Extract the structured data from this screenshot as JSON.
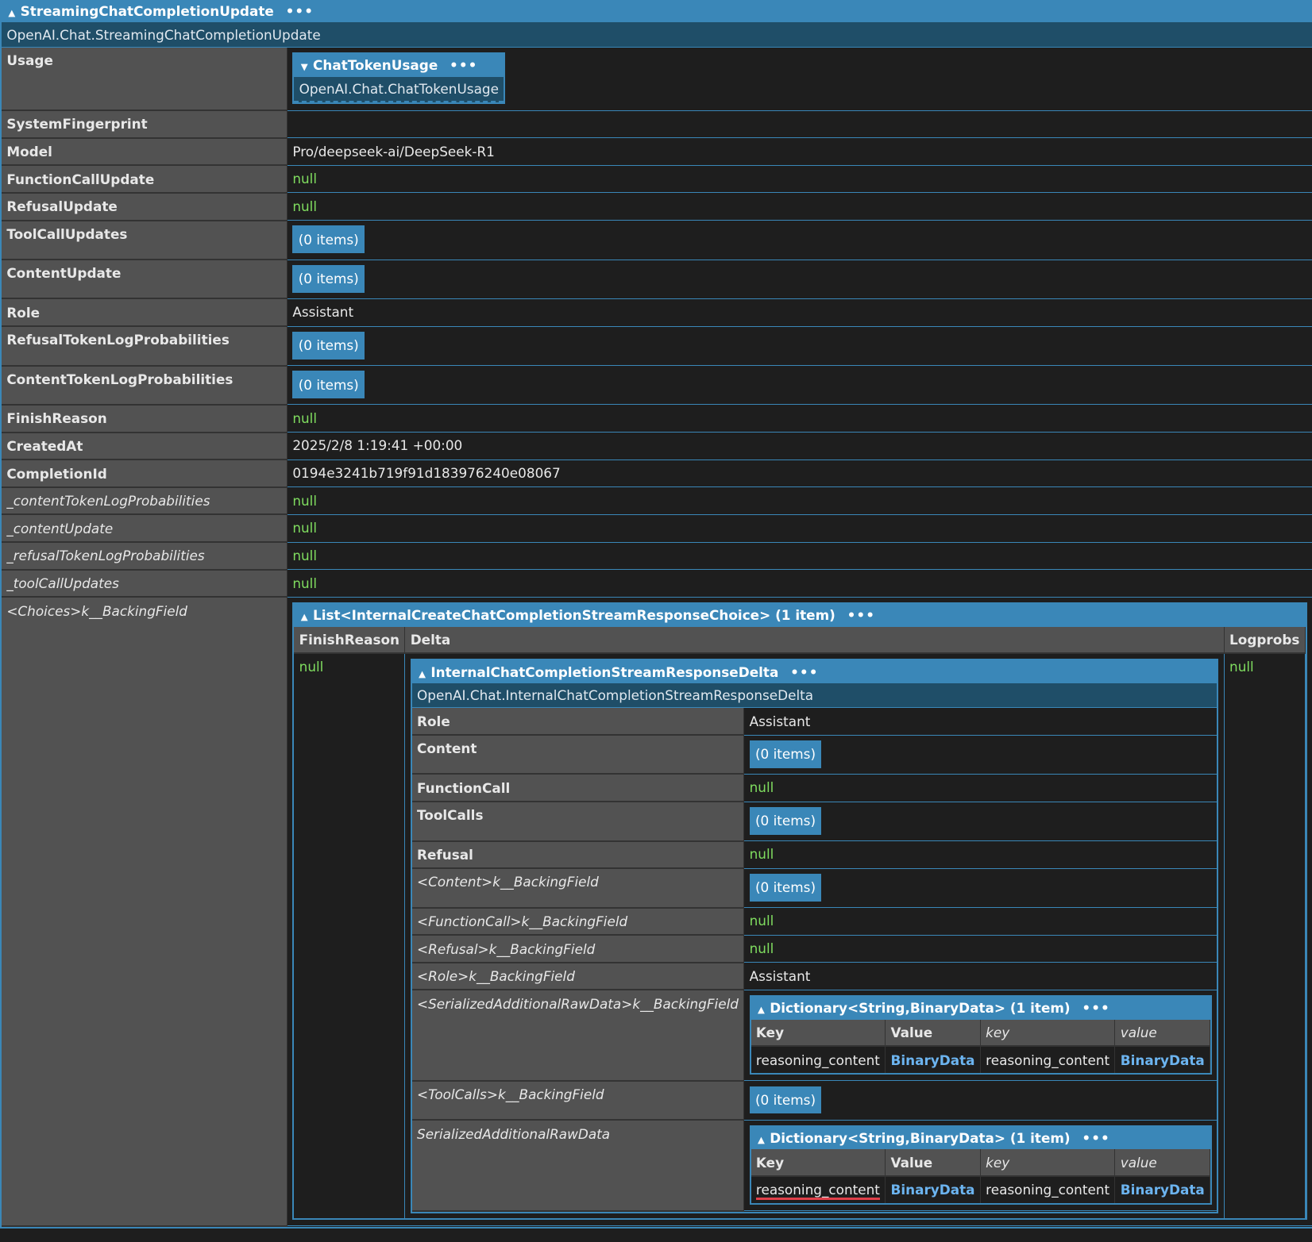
{
  "root": {
    "title": "StreamingChatCompletionUpdate",
    "type_name": "OpenAI.Chat.StreamingChatCompletionUpdate",
    "rows": [
      {
        "key": "Usage",
        "value": {
          "kind": "object",
          "collapsed": true,
          "title": "ChatTokenUsage",
          "type_name": "OpenAI.Chat.ChatTokenUsage"
        }
      },
      {
        "key": "SystemFingerprint",
        "value": {
          "kind": "text",
          "text": ""
        }
      },
      {
        "key": "Model",
        "value": {
          "kind": "text",
          "text": "Pro/deepseek-ai/DeepSeek-R1"
        }
      },
      {
        "key": "FunctionCallUpdate",
        "value": {
          "kind": "null",
          "text": "null"
        }
      },
      {
        "key": "RefusalUpdate",
        "value": {
          "kind": "null",
          "text": "null"
        }
      },
      {
        "key": "ToolCallUpdates",
        "value": {
          "kind": "items",
          "text": "(0 items)"
        }
      },
      {
        "key": "ContentUpdate",
        "value": {
          "kind": "items",
          "text": "(0 items)"
        }
      },
      {
        "key": "Role",
        "value": {
          "kind": "text",
          "text": "Assistant"
        }
      },
      {
        "key": "RefusalTokenLogProbabilities",
        "value": {
          "kind": "items",
          "text": "(0 items)"
        }
      },
      {
        "key": "ContentTokenLogProbabilities",
        "value": {
          "kind": "items",
          "text": "(0 items)"
        }
      },
      {
        "key": "FinishReason",
        "value": {
          "kind": "null",
          "text": "null"
        }
      },
      {
        "key": "CreatedAt",
        "value": {
          "kind": "text",
          "text": "2025/2/8 1:19:41 +00:00"
        }
      },
      {
        "key": "CompletionId",
        "value": {
          "kind": "text",
          "text": "0194e3241b719f91d183976240e08067"
        }
      },
      {
        "key": "_contentTokenLogProbabilities",
        "italic": true,
        "value": {
          "kind": "null",
          "text": "null"
        }
      },
      {
        "key": "_contentUpdate",
        "italic": true,
        "value": {
          "kind": "null",
          "text": "null"
        }
      },
      {
        "key": "_refusalTokenLogProbabilities",
        "italic": true,
        "value": {
          "kind": "null",
          "text": "null"
        }
      },
      {
        "key": "_toolCallUpdates",
        "italic": true,
        "value": {
          "kind": "null",
          "text": "null"
        }
      },
      {
        "key": "<Choices>k__BackingField",
        "italic": true,
        "value": {
          "kind": "list",
          "title": "List<InternalCreateChatCompletionStreamResponseChoice> (1 item)",
          "columns": [
            "FinishReason",
            "Delta",
            "Logprobs"
          ],
          "rows": [
            {
              "FinishReason": {
                "kind": "null",
                "text": "null"
              },
              "Logprobs": {
                "kind": "null",
                "text": "null"
              },
              "Delta": {
                "kind": "object",
                "title": "InternalChatCompletionStreamResponseDelta",
                "type_name": "OpenAI.Chat.InternalChatCompletionStreamResponseDelta",
                "rows": [
                  {
                    "key": "Role",
                    "value": {
                      "kind": "text",
                      "text": "Assistant"
                    }
                  },
                  {
                    "key": "Content",
                    "value": {
                      "kind": "items",
                      "text": "(0 items)"
                    }
                  },
                  {
                    "key": "FunctionCall",
                    "value": {
                      "kind": "null",
                      "text": "null"
                    }
                  },
                  {
                    "key": "ToolCalls",
                    "value": {
                      "kind": "items",
                      "text": "(0 items)"
                    }
                  },
                  {
                    "key": "Refusal",
                    "value": {
                      "kind": "null",
                      "text": "null"
                    }
                  },
                  {
                    "key": "<Content>k__BackingField",
                    "italic": true,
                    "value": {
                      "kind": "items",
                      "text": "(0 items)"
                    }
                  },
                  {
                    "key": "<FunctionCall>k__BackingField",
                    "italic": true,
                    "value": {
                      "kind": "null",
                      "text": "null"
                    }
                  },
                  {
                    "key": "<Refusal>k__BackingField",
                    "italic": true,
                    "value": {
                      "kind": "null",
                      "text": "null"
                    }
                  },
                  {
                    "key": "<Role>k__BackingField",
                    "italic": true,
                    "value": {
                      "kind": "text",
                      "text": "Assistant"
                    }
                  },
                  {
                    "key": "<SerializedAdditionalRawData>k__BackingField",
                    "italic": true,
                    "value": {
                      "kind": "dict",
                      "title": "Dictionary<String,BinaryData> (1 item)",
                      "columns": [
                        "Key",
                        "Value",
                        "key",
                        "value"
                      ],
                      "cells": [
                        "reasoning_content",
                        "BinaryData",
                        "reasoning_content",
                        "BinaryData"
                      ]
                    }
                  },
                  {
                    "key": "<ToolCalls>k__BackingField",
                    "italic": true,
                    "value": {
                      "kind": "items",
                      "text": "(0 items)"
                    }
                  },
                  {
                    "key": "SerializedAdditionalRawData",
                    "italic": true,
                    "value": {
                      "kind": "dict",
                      "title": "Dictionary<String,BinaryData> (1 item)",
                      "underline_first": true,
                      "columns": [
                        "Key",
                        "Value",
                        "key",
                        "value"
                      ],
                      "cells": [
                        "reasoning_content",
                        "BinaryData",
                        "reasoning_content",
                        "BinaryData"
                      ]
                    }
                  }
                ]
              }
            }
          ]
        }
      }
    ]
  },
  "colors": {
    "header": "#3a87b8",
    "type_row": "#1f4e68",
    "null": "#7fdc5f",
    "link": "#6cb4f0",
    "key_bg": "#525252",
    "value_bg": "#1e1e1e",
    "annotation_underline": "#e0404a"
  },
  "icons": {
    "expand": "triangle-up-icon",
    "collapsed": "triangle-down-icon",
    "menu": "ellipsis-icon"
  }
}
